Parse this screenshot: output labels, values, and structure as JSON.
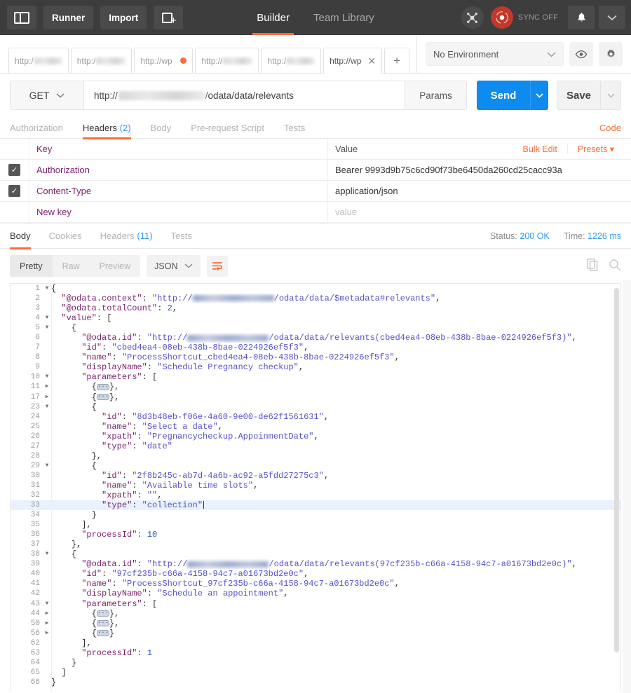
{
  "topbar": {
    "sidebar_toggle": "sidebar-toggle",
    "runner_label": "Runner",
    "import_label": "Import",
    "new_tab_label": "new-request",
    "tabs": [
      {
        "label": "Builder",
        "active": true
      },
      {
        "label": "Team Library",
        "active": false
      }
    ],
    "sync_label": "SYNC OFF",
    "accent_color": "#ff6c37",
    "sync_color": "#c0392b"
  },
  "request_tabs": {
    "items": [
      {
        "label": "http:/",
        "redacted": true,
        "state": "saved"
      },
      {
        "label": "http:/",
        "redacted": true,
        "state": "saved"
      },
      {
        "label": "http://wp",
        "redacted": false,
        "state": "unsaved"
      },
      {
        "label": "http://",
        "redacted": true,
        "state": "saved"
      },
      {
        "label": "http:/",
        "redacted": true,
        "state": "saved"
      },
      {
        "label": "http://wp",
        "redacted": false,
        "state": "active"
      }
    ],
    "add_label": "+"
  },
  "environment": {
    "selected": "No Environment",
    "eye_icon": "eye-icon",
    "settings_icon": "gear-icon"
  },
  "url_bar": {
    "method": "GET",
    "url_prefix": "http://",
    "url_suffix": "/odata/data/relevants",
    "params_label": "Params",
    "send_label": "Send",
    "save_label": "Save",
    "send_color": "#0f8bf0"
  },
  "request_tabs_row": {
    "items": [
      {
        "label": "Authorization",
        "count": "",
        "active": false
      },
      {
        "label": "Headers",
        "count": "(2)",
        "active": true
      },
      {
        "label": "Body",
        "count": "",
        "active": false
      },
      {
        "label": "Pre-request Script",
        "count": "",
        "active": false
      },
      {
        "label": "Tests",
        "count": "",
        "active": false
      }
    ],
    "code_link": "Code"
  },
  "headers_table": {
    "columns": [
      "Key",
      "Value"
    ],
    "bulk_edit": "Bulk Edit",
    "presets": "Presets",
    "rows": [
      {
        "checked": true,
        "key": "Authorization",
        "value": "Bearer 9993d9b75c6cd90f73be6450da260cd25cacc93a"
      },
      {
        "checked": true,
        "key": "Content-Type",
        "value": "application/json"
      }
    ],
    "new_row": {
      "key_placeholder": "New key",
      "value_placeholder": "value"
    }
  },
  "response": {
    "tabs": [
      {
        "label": "Body",
        "count": "",
        "active": true
      },
      {
        "label": "Cookies",
        "count": "",
        "active": false
      },
      {
        "label": "Headers",
        "count": "(11)",
        "active": false
      },
      {
        "label": "Tests",
        "count": "",
        "active": false
      }
    ],
    "status_label": "Status:",
    "status_value": "200 OK",
    "time_label": "Time:",
    "time_value": "1226 ms",
    "view_modes": [
      {
        "label": "Pretty",
        "active": true
      },
      {
        "label": "Raw",
        "active": false
      },
      {
        "label": "Preview",
        "active": false
      }
    ],
    "format": "JSON",
    "wrap_icon": "wrap-lines-icon",
    "copy_icon": "copy-icon",
    "search_icon": "search-icon"
  },
  "code": {
    "active_line": 33,
    "lines": [
      {
        "n": 1,
        "fold": "down",
        "indent": 0,
        "tokens": [
          {
            "t": "p",
            "v": "{"
          }
        ]
      },
      {
        "n": 2,
        "fold": "",
        "indent": 1,
        "tokens": [
          {
            "t": "k",
            "v": "\"@odata.context\""
          },
          {
            "t": "p",
            "v": ": "
          },
          {
            "t": "s",
            "v": "\"http://"
          },
          {
            "t": "blur",
            "v": ""
          },
          {
            "t": "s",
            "v": "/odata/data/$metadata#relevants\""
          },
          {
            "t": "p",
            "v": ","
          }
        ]
      },
      {
        "n": 3,
        "fold": "",
        "indent": 1,
        "tokens": [
          {
            "t": "k",
            "v": "\"@odata.totalCount\""
          },
          {
            "t": "p",
            "v": ": "
          },
          {
            "t": "n",
            "v": "2"
          },
          {
            "t": "p",
            "v": ","
          }
        ]
      },
      {
        "n": 4,
        "fold": "down",
        "indent": 1,
        "tokens": [
          {
            "t": "k",
            "v": "\"value\""
          },
          {
            "t": "p",
            "v": ": ["
          }
        ]
      },
      {
        "n": 5,
        "fold": "down",
        "indent": 2,
        "tokens": [
          {
            "t": "p",
            "v": "{"
          }
        ]
      },
      {
        "n": 6,
        "fold": "",
        "indent": 3,
        "tokens": [
          {
            "t": "k",
            "v": "\"@odata.id\""
          },
          {
            "t": "p",
            "v": ": "
          },
          {
            "t": "s",
            "v": "\"http://"
          },
          {
            "t": "blur",
            "v": ""
          },
          {
            "t": "s",
            "v": "/odata/data/relevants(cbed4ea4-08eb-438b-8bae-0224926ef5f3)\""
          },
          {
            "t": "p",
            "v": ","
          }
        ]
      },
      {
        "n": 7,
        "fold": "",
        "indent": 3,
        "tokens": [
          {
            "t": "k",
            "v": "\"id\""
          },
          {
            "t": "p",
            "v": ": "
          },
          {
            "t": "s",
            "v": "\"cbed4ea4-08eb-438b-8bae-0224926ef5f3\""
          },
          {
            "t": "p",
            "v": ","
          }
        ]
      },
      {
        "n": 8,
        "fold": "",
        "indent": 3,
        "tokens": [
          {
            "t": "k",
            "v": "\"name\""
          },
          {
            "t": "p",
            "v": ": "
          },
          {
            "t": "s",
            "v": "\"ProcessShortcut_cbed4ea4-08eb-438b-8bae-0224926ef5f3\""
          },
          {
            "t": "p",
            "v": ","
          }
        ]
      },
      {
        "n": 9,
        "fold": "",
        "indent": 3,
        "tokens": [
          {
            "t": "k",
            "v": "\"displayName\""
          },
          {
            "t": "p",
            "v": ": "
          },
          {
            "t": "s",
            "v": "\"Schedule Pregnancy checkup\""
          },
          {
            "t": "p",
            "v": ","
          }
        ]
      },
      {
        "n": 10,
        "fold": "down",
        "indent": 3,
        "tokens": [
          {
            "t": "k",
            "v": "\"parameters\""
          },
          {
            "t": "p",
            "v": ": ["
          }
        ]
      },
      {
        "n": 11,
        "fold": "right",
        "indent": 4,
        "tokens": [
          {
            "t": "p",
            "v": "{"
          },
          {
            "t": "foldw",
            "v": "···"
          },
          {
            "t": "p",
            "v": "},"
          }
        ]
      },
      {
        "n": 17,
        "fold": "right",
        "indent": 4,
        "tokens": [
          {
            "t": "p",
            "v": "{"
          },
          {
            "t": "foldw",
            "v": "···"
          },
          {
            "t": "p",
            "v": "},"
          }
        ]
      },
      {
        "n": 23,
        "fold": "down",
        "indent": 4,
        "tokens": [
          {
            "t": "p",
            "v": "{"
          }
        ]
      },
      {
        "n": 24,
        "fold": "",
        "indent": 5,
        "tokens": [
          {
            "t": "k",
            "v": "\"id\""
          },
          {
            "t": "p",
            "v": ": "
          },
          {
            "t": "s",
            "v": "\"8d3b48eb-f06e-4a60-9e00-de62f1561631\""
          },
          {
            "t": "p",
            "v": ","
          }
        ]
      },
      {
        "n": 25,
        "fold": "",
        "indent": 5,
        "tokens": [
          {
            "t": "k",
            "v": "\"name\""
          },
          {
            "t": "p",
            "v": ": "
          },
          {
            "t": "s",
            "v": "\"Select a date\""
          },
          {
            "t": "p",
            "v": ","
          }
        ]
      },
      {
        "n": 26,
        "fold": "",
        "indent": 5,
        "tokens": [
          {
            "t": "k",
            "v": "\"xpath\""
          },
          {
            "t": "p",
            "v": ": "
          },
          {
            "t": "s",
            "v": "\"Pregnancycheckup.AppoinmentDate\""
          },
          {
            "t": "p",
            "v": ","
          }
        ]
      },
      {
        "n": 27,
        "fold": "",
        "indent": 5,
        "tokens": [
          {
            "t": "k",
            "v": "\"type\""
          },
          {
            "t": "p",
            "v": ": "
          },
          {
            "t": "s",
            "v": "\"date\""
          }
        ]
      },
      {
        "n": 28,
        "fold": "",
        "indent": 4,
        "tokens": [
          {
            "t": "p",
            "v": "},"
          }
        ]
      },
      {
        "n": 29,
        "fold": "down",
        "indent": 4,
        "tokens": [
          {
            "t": "p",
            "v": "{"
          }
        ]
      },
      {
        "n": 30,
        "fold": "",
        "indent": 5,
        "tokens": [
          {
            "t": "k",
            "v": "\"id\""
          },
          {
            "t": "p",
            "v": ": "
          },
          {
            "t": "s",
            "v": "\"2f8b245c-ab7d-4a6b-ac92-a5fdd27275c3\""
          },
          {
            "t": "p",
            "v": ","
          }
        ]
      },
      {
        "n": 31,
        "fold": "",
        "indent": 5,
        "tokens": [
          {
            "t": "k",
            "v": "\"name\""
          },
          {
            "t": "p",
            "v": ": "
          },
          {
            "t": "s",
            "v": "\"Available time slots\""
          },
          {
            "t": "p",
            "v": ","
          }
        ]
      },
      {
        "n": 32,
        "fold": "",
        "indent": 5,
        "tokens": [
          {
            "t": "k",
            "v": "\"xpath\""
          },
          {
            "t": "p",
            "v": ": "
          },
          {
            "t": "s",
            "v": "\"\""
          },
          {
            "t": "p",
            "v": ","
          }
        ]
      },
      {
        "n": 33,
        "fold": "",
        "indent": 5,
        "tokens": [
          {
            "t": "k",
            "v": "\"type\""
          },
          {
            "t": "p",
            "v": ": "
          },
          {
            "t": "s",
            "v": "\"collection\""
          },
          {
            "t": "caret",
            "v": ""
          }
        ]
      },
      {
        "n": 34,
        "fold": "",
        "indent": 4,
        "tokens": [
          {
            "t": "p",
            "v": "}"
          }
        ]
      },
      {
        "n": 35,
        "fold": "",
        "indent": 3,
        "tokens": [
          {
            "t": "p",
            "v": "],"
          }
        ]
      },
      {
        "n": 36,
        "fold": "",
        "indent": 3,
        "tokens": [
          {
            "t": "k",
            "v": "\"processId\""
          },
          {
            "t": "p",
            "v": ": "
          },
          {
            "t": "n",
            "v": "10"
          }
        ]
      },
      {
        "n": 37,
        "fold": "",
        "indent": 2,
        "tokens": [
          {
            "t": "p",
            "v": "},"
          }
        ]
      },
      {
        "n": 38,
        "fold": "down",
        "indent": 2,
        "tokens": [
          {
            "t": "p",
            "v": "{"
          }
        ]
      },
      {
        "n": 39,
        "fold": "",
        "indent": 3,
        "tokens": [
          {
            "t": "k",
            "v": "\"@odata.id\""
          },
          {
            "t": "p",
            "v": ": "
          },
          {
            "t": "s",
            "v": "\"http://"
          },
          {
            "t": "blur",
            "v": ""
          },
          {
            "t": "s",
            "v": "/odata/data/relevants(97cf235b-c66a-4158-94c7-a01673bd2e0c)\""
          },
          {
            "t": "p",
            "v": ","
          }
        ]
      },
      {
        "n": 40,
        "fold": "",
        "indent": 3,
        "tokens": [
          {
            "t": "k",
            "v": "\"id\""
          },
          {
            "t": "p",
            "v": ": "
          },
          {
            "t": "s",
            "v": "\"97cf235b-c66a-4158-94c7-a01673bd2e0c\""
          },
          {
            "t": "p",
            "v": ","
          }
        ]
      },
      {
        "n": 41,
        "fold": "",
        "indent": 3,
        "tokens": [
          {
            "t": "k",
            "v": "\"name\""
          },
          {
            "t": "p",
            "v": ": "
          },
          {
            "t": "s",
            "v": "\"ProcessShortcut_97cf235b-c66a-4158-94c7-a01673bd2e0c\""
          },
          {
            "t": "p",
            "v": ","
          }
        ]
      },
      {
        "n": 42,
        "fold": "",
        "indent": 3,
        "tokens": [
          {
            "t": "k",
            "v": "\"displayName\""
          },
          {
            "t": "p",
            "v": ": "
          },
          {
            "t": "s",
            "v": "\"Schedule an appointment\""
          },
          {
            "t": "p",
            "v": ","
          }
        ]
      },
      {
        "n": 43,
        "fold": "down",
        "indent": 3,
        "tokens": [
          {
            "t": "k",
            "v": "\"parameters\""
          },
          {
            "t": "p",
            "v": ": ["
          }
        ]
      },
      {
        "n": 44,
        "fold": "right",
        "indent": 4,
        "tokens": [
          {
            "t": "p",
            "v": "{"
          },
          {
            "t": "foldw",
            "v": "···"
          },
          {
            "t": "p",
            "v": "},"
          }
        ]
      },
      {
        "n": 50,
        "fold": "right",
        "indent": 4,
        "tokens": [
          {
            "t": "p",
            "v": "{"
          },
          {
            "t": "foldw",
            "v": "···"
          },
          {
            "t": "p",
            "v": "},"
          }
        ]
      },
      {
        "n": 56,
        "fold": "right",
        "indent": 4,
        "tokens": [
          {
            "t": "p",
            "v": "{"
          },
          {
            "t": "foldw",
            "v": "···"
          },
          {
            "t": "p",
            "v": "}"
          }
        ]
      },
      {
        "n": 62,
        "fold": "",
        "indent": 3,
        "tokens": [
          {
            "t": "p",
            "v": "],"
          }
        ]
      },
      {
        "n": 63,
        "fold": "",
        "indent": 3,
        "tokens": [
          {
            "t": "k",
            "v": "\"processId\""
          },
          {
            "t": "p",
            "v": ": "
          },
          {
            "t": "n",
            "v": "1"
          }
        ]
      },
      {
        "n": 64,
        "fold": "",
        "indent": 2,
        "tokens": [
          {
            "t": "p",
            "v": "}"
          }
        ]
      },
      {
        "n": 65,
        "fold": "",
        "indent": 1,
        "tokens": [
          {
            "t": "p",
            "v": "]"
          }
        ]
      },
      {
        "n": 66,
        "fold": "",
        "indent": 0,
        "tokens": [
          {
            "t": "p",
            "v": "}"
          }
        ]
      }
    ]
  }
}
